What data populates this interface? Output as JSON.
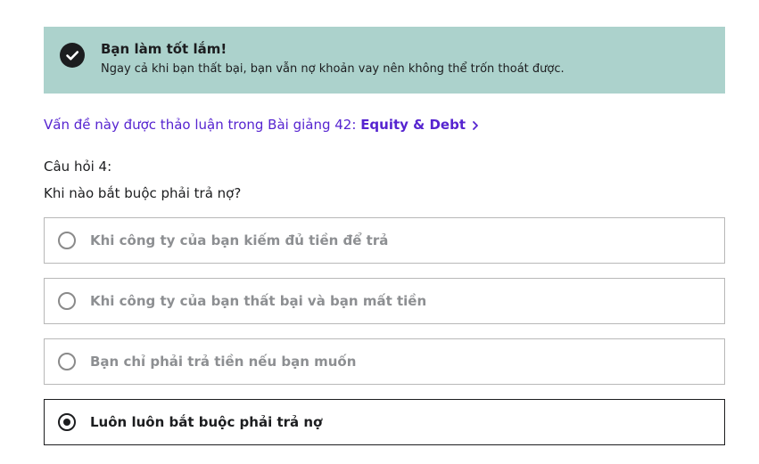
{
  "feedback": {
    "icon": "check-circle-icon",
    "title": "Bạn làm tốt lắm!",
    "message": "Ngay cả khi bạn thất bại, bạn vẫn nợ khoản vay nên không thể trốn thoát được.",
    "background_color": "#acd2cc"
  },
  "lecture_link": {
    "prefix": "Vấn đề này được thảo luận trong Bài giảng 42: ",
    "title": "Equity & Debt",
    "icon": "chevron-right-icon",
    "color": "#5624d0"
  },
  "question": {
    "number_label": "Câu hỏi 4:",
    "text": "Khi nào bắt buộc phải trả nợ?",
    "options": [
      {
        "label": "Khi công ty của bạn kiếm đủ tiền để trả",
        "selected": false
      },
      {
        "label": "Khi công ty của bạn thất bại và bạn mất tiền",
        "selected": false
      },
      {
        "label": "Bạn chỉ phải trả tiền nếu bạn muốn",
        "selected": false
      },
      {
        "label": "Luôn luôn bắt buộc phải trả nợ",
        "selected": true
      }
    ]
  }
}
